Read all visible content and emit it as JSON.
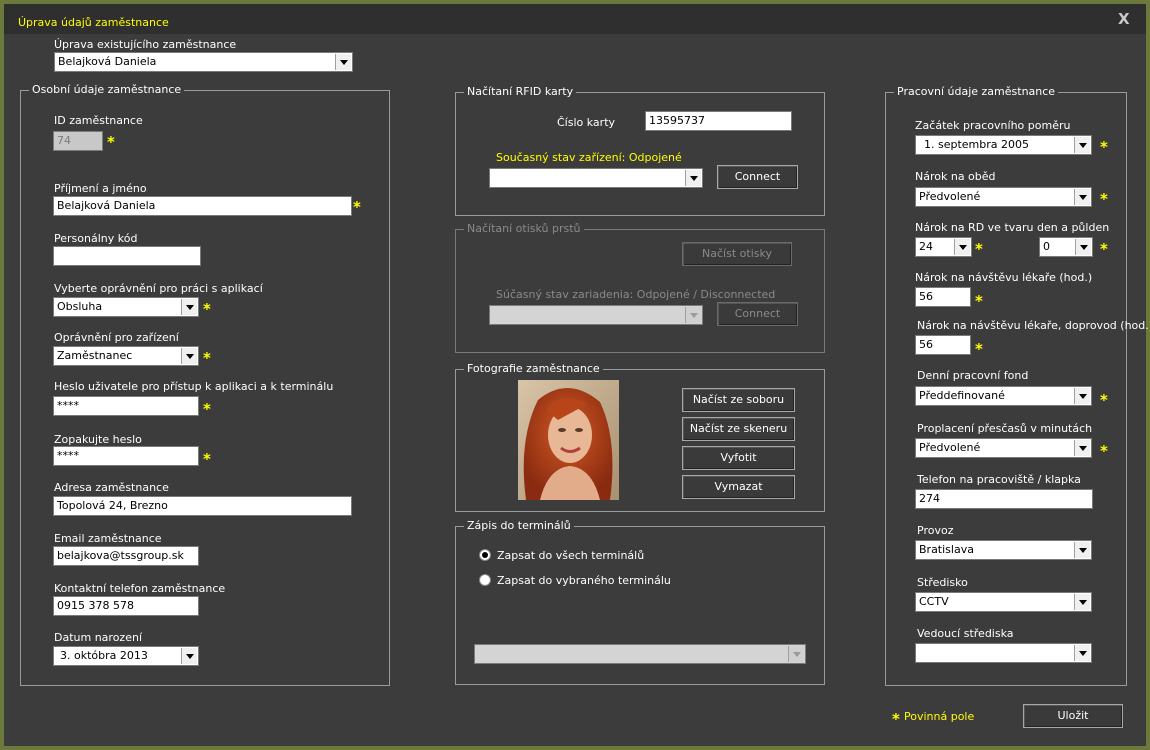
{
  "window": {
    "title": "Úprava údajů zaměstnance",
    "close": "X"
  },
  "edit_existing": {
    "label": "Úprava existujícího zaměstnance",
    "value": "Belajková Daniela"
  },
  "personal": {
    "legend": "Osobní údaje zaměstnance",
    "id_label": "ID zaměstnance",
    "id_value": "74",
    "name_label": "Příjmení a jméno",
    "name_value": "Belajková Daniela",
    "pcode_label": "Personálny kód",
    "pcode_value": "",
    "perm_app_label": "Vyberte oprávnění pro práci s aplikací",
    "perm_app_value": "Obsluha",
    "perm_dev_label": "Oprávnění pro zařízení",
    "perm_dev_value": "Zaměstnanec",
    "pwd_label": "Heslo uživatele pro přístup k aplikaci a k terminálu",
    "pwd_value": "****",
    "pwd2_label": "Zopakujte heslo",
    "pwd2_value": "****",
    "addr_label": "Adresa zaměstnance",
    "addr_value": "Topolová 24, Brezno",
    "email_label": "Email zaměstnance",
    "email_value": "belajkova@tssgroup.sk",
    "phone_label": "Kontaktní telefon zaměstnance",
    "phone_value": "0915 378 578",
    "dob_label": "Datum narození",
    "dob_value": "3.   októbra   2013"
  },
  "rfid": {
    "legend": "Načítaní RFID karty",
    "card_label": "Číslo karty",
    "card_value": "13595737",
    "status": "Současný stav zařízení: Odpojené",
    "device_value": "",
    "connect": "Connect"
  },
  "finger": {
    "legend": "Načítaní otisků prstů",
    "load": "Načíst otisky",
    "status": "Súčasný stav zariadenia: Odpojené / Disconnected",
    "device_value": "",
    "connect": "Connect"
  },
  "photo": {
    "legend": "Fotografie zaměstnance",
    "from_file": "Načíst ze soboru",
    "from_scanner": "Načíst ze skeneru",
    "take": "Vyfotit",
    "delete": "Vymazat"
  },
  "terminals": {
    "legend": "Zápis do terminálů",
    "all": "Zapsat do všech terminálů",
    "selected": "Zapsat do vybraného terminálu",
    "select_value": ""
  },
  "work": {
    "legend": "Pracovní údaje zaměstnance",
    "start_label": "Začátek pracovního poměru",
    "start_value": "1. septembra 2005",
    "lunch_label": "Nárok na oběd",
    "lunch_value": "Předvolené",
    "rd_label": "Nárok na RD ve tvaru den a půlden",
    "rd_days": "24",
    "rd_half": "0",
    "doctor_label": "Nárok na návštěvu lékaře (hod.)",
    "doctor_value": "56",
    "doctor2_label": "Nárok na návštěvu lékaře, doprovod (hod.)",
    "doctor2_value": "56",
    "fund_label": "Denní pracovní fond",
    "fund_value": "Předdefinované",
    "overtime_label": "Proplacení přesčasů v minutách",
    "overtime_value": "Předvolené",
    "tel_label": "Telefon na pracoviště / klapka",
    "tel_value": "274",
    "op_label": "Provoz",
    "op_value": "Bratislava",
    "center_label": "Středisko",
    "center_value": "CCTV",
    "head_label": "Vedoucí střediska",
    "head_value": ""
  },
  "footer": {
    "required": "Povinná pole",
    "save": "Uložit",
    "star": "*"
  }
}
